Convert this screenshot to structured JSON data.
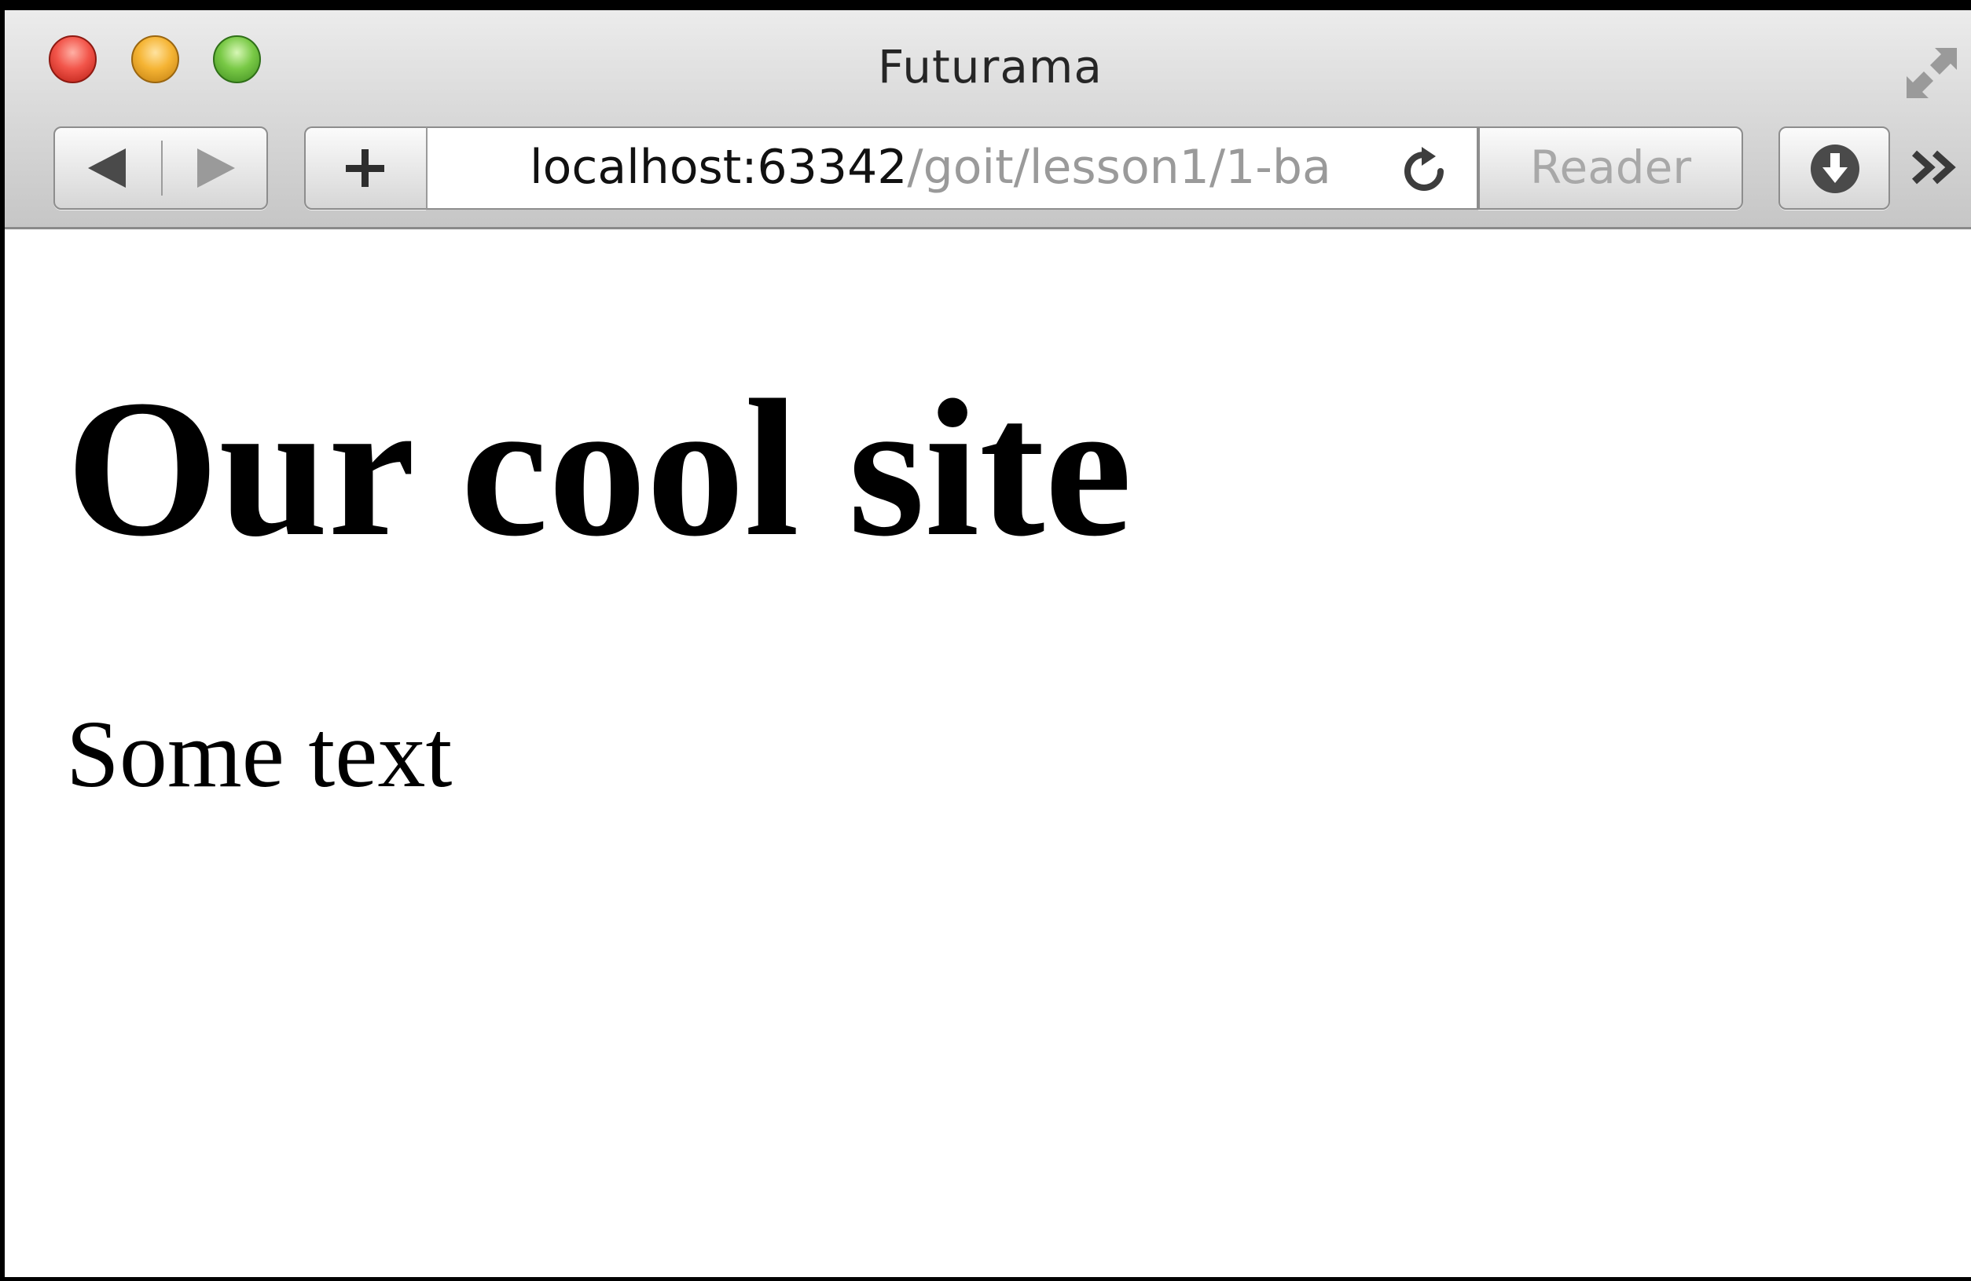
{
  "window": {
    "title": "Futurama"
  },
  "toolbar": {
    "back_icon": "back-arrow-icon",
    "forward_icon": "forward-arrow-icon",
    "new_tab_icon": "plus-icon",
    "reader_label": "Reader",
    "download_icon": "download-icon",
    "overflow_icon": "chevron-double-right-icon",
    "reload_icon": "reload-icon",
    "fullscreen_icon": "fullscreen-icon"
  },
  "address_bar": {
    "host": "localhost:63342",
    "path": "/goit/lesson1/1-ba"
  },
  "page": {
    "heading": "Our cool site",
    "paragraph": "Some text"
  },
  "colors": {
    "close": "#f2554a",
    "minimize": "#f5b434",
    "zoom": "#79c946",
    "url_path": "#9a9a9a",
    "reader_text": "#a8a8a8"
  }
}
